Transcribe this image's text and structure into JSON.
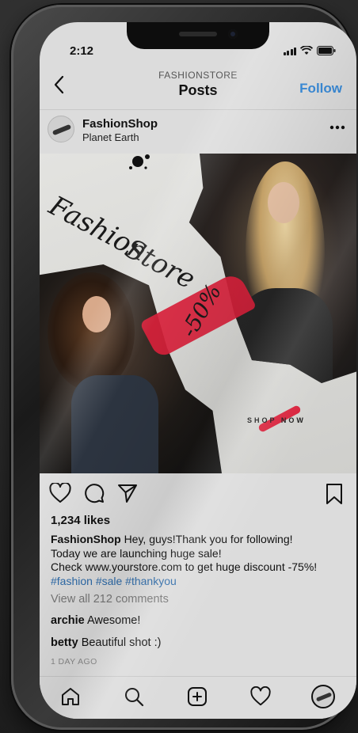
{
  "status": {
    "time": "2:12"
  },
  "header": {
    "subtitle": "FASHIONSTORE",
    "title": "Posts",
    "follow_label": "Follow"
  },
  "post": {
    "account_name": "FashionShop",
    "location": "Planet Earth",
    "more_icon": "ellipsis-icon",
    "image": {
      "script_line1": "Fashion",
      "script_line2": "Store",
      "discount": "-50%",
      "cta": "SHOP NOW"
    },
    "likes": "1,234 likes",
    "caption": {
      "user": "FashionShop",
      "line1": "Hey, guys!Thank you for following!",
      "line2": "Today we are launching huge sale!",
      "line3": "Check www.yourstore.com to get huge discount -75%!",
      "tags": "#fashion #sale #thankyou"
    },
    "view_comments": "View all 212 comments",
    "comments": [
      {
        "user": "archie",
        "text": "Awesome!"
      },
      {
        "user": "betty",
        "text": "Beautiful shot :)"
      }
    ],
    "time_ago": "1 DAY AGO"
  },
  "tab_bar": {
    "items": [
      "home-icon",
      "search-icon",
      "add-post-icon",
      "activity-heart-icon",
      "profile-avatar"
    ]
  },
  "colors": {
    "accent_blue": "#3a8ad6",
    "hashtag_blue": "#2d6aa8",
    "brush_red": "#d8213b",
    "screen_bg": "#dcdcdc"
  }
}
